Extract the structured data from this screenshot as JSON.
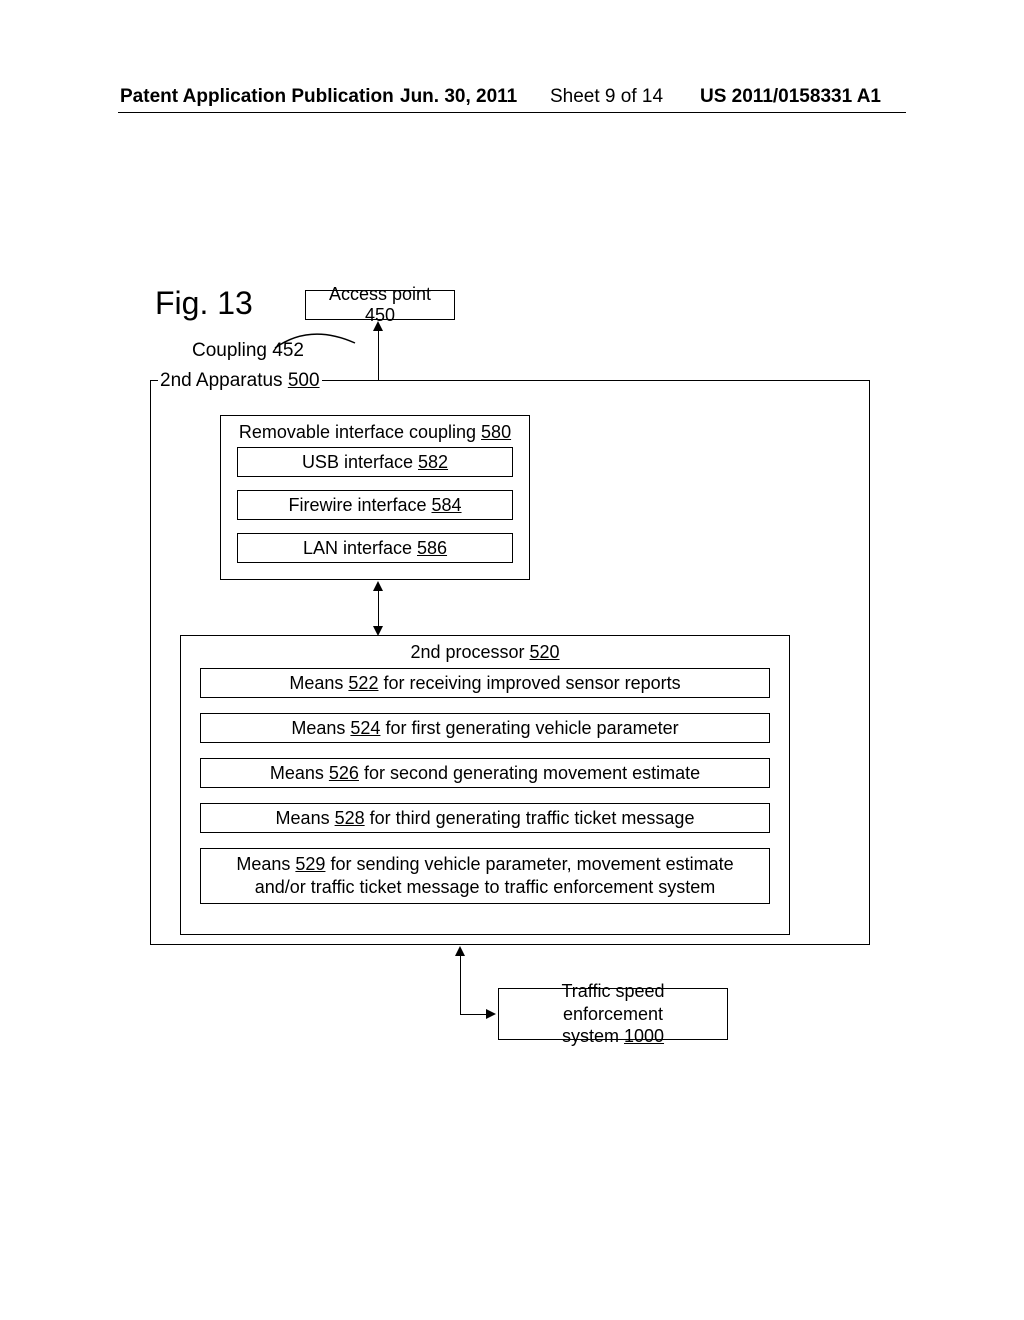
{
  "header": {
    "publication": "Patent Application Publication",
    "date": "Jun. 30, 2011",
    "sheet": "Sheet 9 of 14",
    "docnum": "US 2011/0158331 A1"
  },
  "figure_label": "Fig. 13",
  "access_point": {
    "text": "Access point 450"
  },
  "coupling": {
    "text": "Coupling 452"
  },
  "apparatus": {
    "label": "2nd Apparatus ",
    "num": "500"
  },
  "interface_block": {
    "title_pre": "Removable interface coupling ",
    "title_num": "580",
    "usb_pre": "USB interface ",
    "usb_num": "582",
    "fw_pre": "Firewire interface ",
    "fw_num": "584",
    "lan_pre": "LAN interface ",
    "lan_num": "586"
  },
  "processor_block": {
    "title_pre": "2nd processor ",
    "title_num": "520",
    "means522_pre": "Means ",
    "means522_num": "522",
    "means522_post": " for receiving improved sensor reports",
    "means524_pre": "Means ",
    "means524_num": "524",
    "means524_post": " for first generating vehicle parameter",
    "means526_pre": "Means ",
    "means526_num": "526",
    "means526_post": " for second generating movement estimate",
    "means528_pre": "Means ",
    "means528_num": "528",
    "means528_post": " for third generating traffic ticket message",
    "means529_pre": "Means ",
    "means529_num": "529",
    "means529_post": " for sending vehicle parameter, movement estimate and/or traffic ticket message to traffic enforcement system"
  },
  "traffic_system": {
    "line1": "Traffic speed enforcement",
    "line2_pre": "system ",
    "line2_num": "1000"
  }
}
